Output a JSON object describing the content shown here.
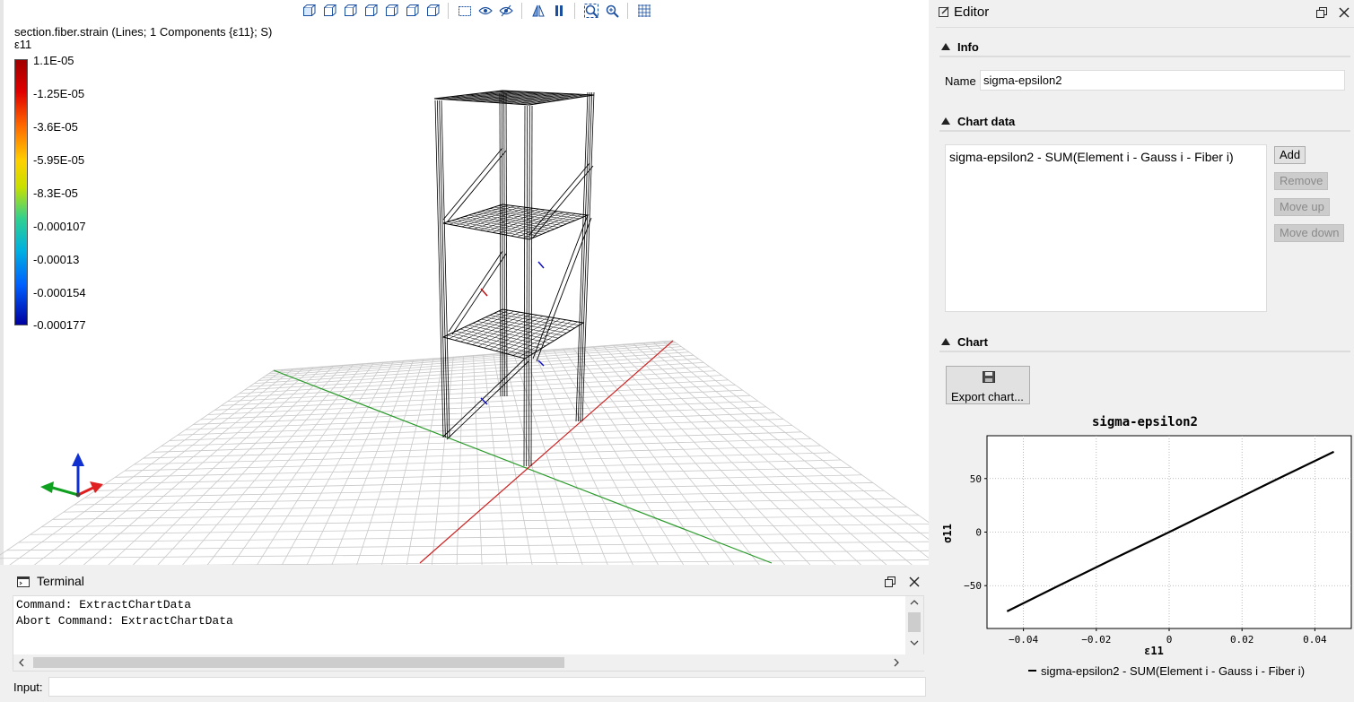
{
  "viewport": {
    "toolbar_icons": [
      "iso-view-icon",
      "front-view-icon",
      "back-view-icon",
      "left-view-icon",
      "right-view-icon",
      "top-view-icon",
      "bottom-view-icon",
      "perspective-icon",
      "show-icon",
      "hide-icon",
      "mirror-icon",
      "split-icon",
      "zoom-fit-icon",
      "zoom-icon",
      "grid-icon"
    ],
    "result_title": "section.fiber.strain (Lines; 1 Components {ε11}; S)",
    "result_component": "ε11",
    "legend_labels": [
      "1.1E-05",
      "-1.25E-05",
      "-3.6E-05",
      "-5.95E-05",
      "-8.3E-05",
      "-0.000107",
      "-0.00013",
      "-0.000154",
      "-0.000177"
    ]
  },
  "terminal": {
    "title": "Terminal",
    "lines": [
      "Command: ExtractChartData",
      "Abort Command: ExtractChartData"
    ],
    "input_label": "Input:",
    "input_value": ""
  },
  "editor": {
    "title": "Editor",
    "sections": {
      "info": "Info",
      "chart_data": "Chart data",
      "chart": "Chart"
    },
    "name_label": "Name",
    "name_value": "sigma-epsilon2",
    "chart_data_items": [
      "sigma-epsilon2 - SUM(Element i - Gauss i - Fiber i)"
    ],
    "buttons": {
      "add": "Add",
      "remove": "Remove",
      "move_up": "Move up",
      "move_down": "Move down",
      "export": "Export chart..."
    }
  },
  "chart_data": {
    "type": "line",
    "title": "sigma-epsilon2",
    "xlabel": "ε11",
    "ylabel": "σ11",
    "xlim": [
      -0.05,
      0.05
    ],
    "ylim": [
      -90,
      90
    ],
    "xticks": [
      "−0.04",
      "−0.02",
      "0",
      "0.02",
      "0.04"
    ],
    "xtick_values": [
      -0.04,
      -0.02,
      0,
      0.02,
      0.04
    ],
    "yticks": [
      "50",
      "0",
      "−50"
    ],
    "ytick_values": [
      50,
      0,
      -50
    ],
    "grid": true,
    "legend_position": "bottom",
    "series": [
      {
        "name": "sigma-epsilon2 - SUM(Element i - Gauss i - Fiber i)",
        "color": "#000000",
        "x": [
          -0.0445,
          -0.03,
          -0.015,
          0,
          0.015,
          0.03,
          0.0452
        ],
        "y": [
          -74,
          -49.5,
          -24.5,
          0,
          25,
          50,
          75
        ]
      }
    ]
  }
}
